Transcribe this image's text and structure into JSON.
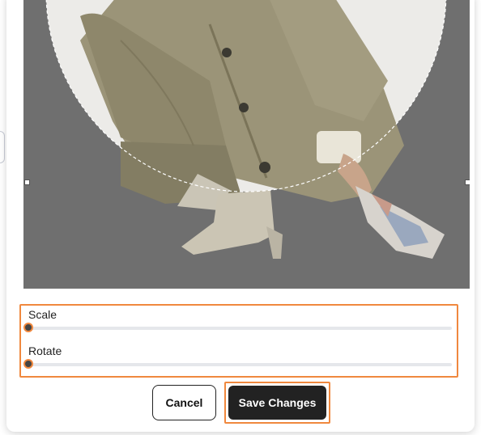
{
  "cropper": {
    "image_alt": "Person crouching in olive trench coat"
  },
  "controls": {
    "scale_label": "Scale",
    "scale_value": 0,
    "rotate_label": "Rotate",
    "rotate_value": 0
  },
  "actions": {
    "cancel_label": "Cancel",
    "save_label": "Save Changes"
  },
  "colors": {
    "highlight": "#f0883e",
    "primary_button": "#222222"
  }
}
